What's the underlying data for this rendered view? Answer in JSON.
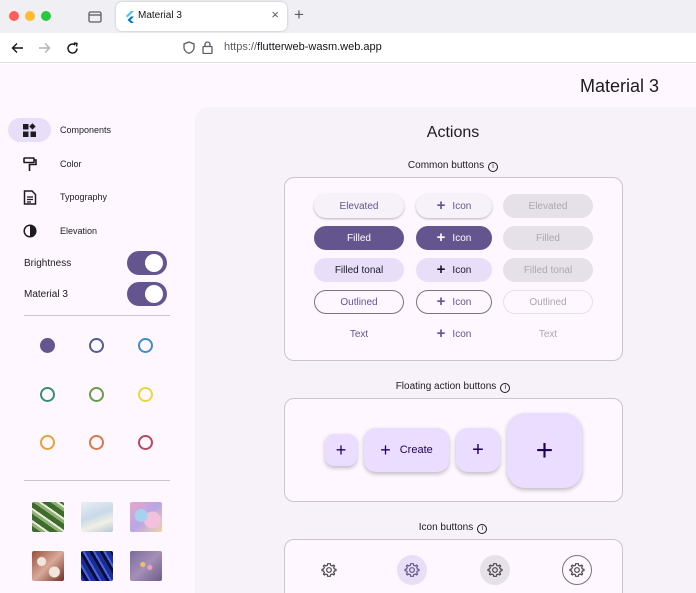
{
  "browser": {
    "tab_title": "Material 3",
    "url_prefix": "https://",
    "url_host": "flutterweb-wasm.web.app"
  },
  "app": {
    "title": "Material 3"
  },
  "rail": {
    "items": [
      {
        "label": "Components",
        "icon": "widgets-icon",
        "active": true
      },
      {
        "label": "Color",
        "icon": "format-paint-icon",
        "active": false
      },
      {
        "label": "Typography",
        "icon": "article-icon",
        "active": false
      },
      {
        "label": "Elevation",
        "icon": "contrast-icon",
        "active": false
      }
    ],
    "toggles": [
      {
        "label": "Brightness",
        "on": true
      },
      {
        "label": "Material 3",
        "on": true
      }
    ],
    "color_seeds": [
      "#65558f",
      "#4f5e8f",
      "#3e8ccf",
      "#3b8f6b",
      "#6b9a4a",
      "#e6d93f",
      "#e4a23a",
      "#d9784a",
      "#b34a5e"
    ],
    "image_seeds": [
      "leaves-image",
      "clouds-image",
      "bubbles-image",
      "flowers-image",
      "stripes-image",
      "fireworks-image"
    ]
  },
  "actions": {
    "title": "Actions",
    "common_buttons": {
      "title": "Common buttons",
      "rows": [
        [
          "Elevated",
          "Icon",
          "Elevated"
        ],
        [
          "Filled",
          "Icon",
          "Filled"
        ],
        [
          "Filled tonal",
          "Icon",
          "Filled tonal"
        ],
        [
          "Outlined",
          "Icon",
          "Outlined"
        ],
        [
          "Text",
          "Icon",
          "Text"
        ]
      ]
    },
    "fab": {
      "title": "Floating action buttons",
      "extended_label": "Create"
    },
    "icon_buttons": {
      "title": "Icon buttons"
    }
  },
  "colors": {
    "primary": "#65558f",
    "secondary_container": "#e8def8",
    "primary_container": "#eaddff",
    "surface": "#fef7ff"
  }
}
